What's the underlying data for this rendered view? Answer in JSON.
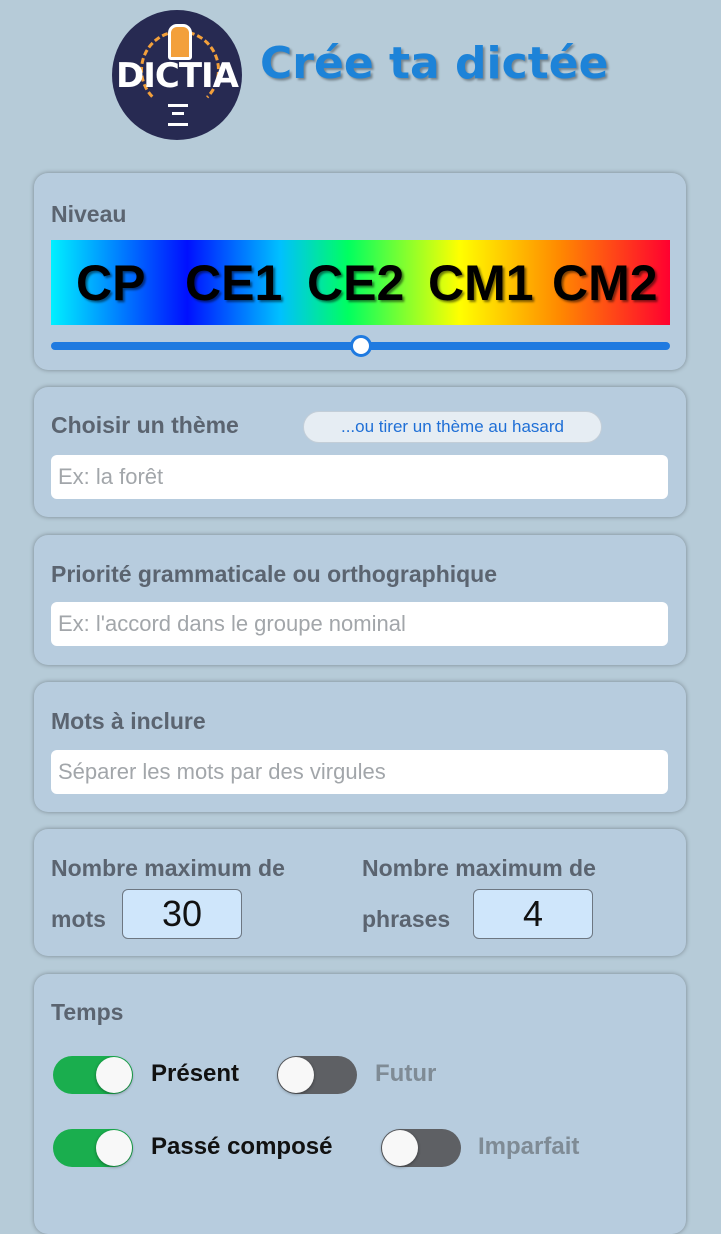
{
  "header": {
    "logo_text": "DICTIA",
    "title": "Crée ta dictée"
  },
  "niveau": {
    "label": "Niveau",
    "levels": [
      "CP",
      "CE1",
      "CE2",
      "CM1",
      "CM2"
    ],
    "slider_value_fraction": 0.5
  },
  "theme": {
    "label": "Choisir un thème",
    "random_button": "...ou tirer un thème au hasard",
    "placeholder": "Ex: la forêt"
  },
  "priorite": {
    "label": "Priorité grammaticale ou orthographique",
    "placeholder": "Ex: l'accord dans le groupe nominal"
  },
  "mots": {
    "label": "Mots à inclure",
    "placeholder": "Séparer les mots par des virgules"
  },
  "limits": {
    "words_label_line1": "Nombre maximum de",
    "words_label_line2": "mots",
    "words_value": "30",
    "sentences_label_line1": "Nombre maximum de",
    "sentences_label_line2": "phrases",
    "sentences_value": "4"
  },
  "temps": {
    "label": "Temps",
    "options": [
      {
        "label": "Présent",
        "on": true
      },
      {
        "label": "Futur",
        "on": false
      },
      {
        "label": "Passé composé",
        "on": true
      },
      {
        "label": "Imparfait",
        "on": false
      }
    ]
  },
  "colors": {
    "accent": "#1d83d8",
    "toggle_on": "#1aae4e",
    "toggle_off": "#5e6064",
    "background": "#b6cbd8"
  }
}
